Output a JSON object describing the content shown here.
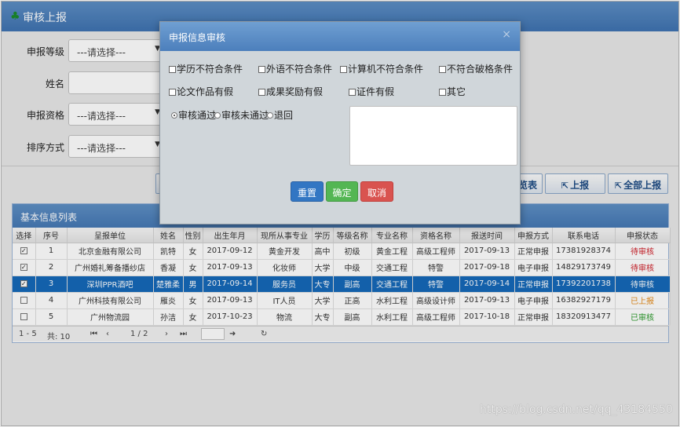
{
  "page": {
    "title": "审核上报",
    "tree_glyph": "♣"
  },
  "search": {
    "fields": [
      {
        "label": "申报等级",
        "type": "select",
        "value": "---请选择---"
      },
      {
        "label": "姓名",
        "type": "input",
        "value": ""
      },
      {
        "label": "申报资格",
        "type": "select",
        "value": "---请选择---"
      },
      {
        "label": "排序方式",
        "type": "select",
        "value": "---请选择---"
      }
    ]
  },
  "actions": {
    "browse_fragment": "览表",
    "report": "上报",
    "report_all": "全部上报"
  },
  "list": {
    "title": "基本信息列表",
    "columns": [
      "选择",
      "序号",
      "呈报单位",
      "姓名",
      "性别",
      "出生年月",
      "现所从事专业",
      "学历",
      "等级名称",
      "专业名称",
      "资格名称",
      "报送时间",
      "申报方式",
      "联系电话",
      "申报状态"
    ],
    "rows": [
      {
        "checked": true,
        "no": "1",
        "unit": "北京金融有限公司",
        "name": "凯特",
        "sex": "女",
        "birth": "2017-09-12",
        "major_now": "黄金开发",
        "edu": "高中",
        "level": "初级",
        "major": "黄金工程",
        "qual": "高级工程师",
        "time": "2017-09-13",
        "mode": "正常申报",
        "phone": "17381928374",
        "status": "待审核",
        "status_class": "st-pending",
        "selected": false
      },
      {
        "checked": true,
        "no": "2",
        "unit": "广州婚礼筹备播纱店",
        "name": "香凝",
        "sex": "女",
        "birth": "2017-09-13",
        "major_now": "化妆师",
        "edu": "大学",
        "level": "中级",
        "major": "交通工程",
        "qual": "特警",
        "time": "2017-09-18",
        "mode": "电子申报",
        "phone": "14829173749",
        "status": "待审核",
        "status_class": "st-pending",
        "selected": false
      },
      {
        "checked": true,
        "no": "3",
        "unit": "深圳PPR酒吧",
        "name": "楚雅柔",
        "sex": "男",
        "birth": "2017-09-14",
        "major_now": "服务员",
        "edu": "大专",
        "level": "副高",
        "major": "交通工程",
        "qual": "特警",
        "time": "2017-09-14",
        "mode": "正常申报",
        "phone": "17392201738",
        "status": "待审核",
        "status_class": "st-pending",
        "selected": true
      },
      {
        "checked": false,
        "no": "4",
        "unit": "广州科技有限公司",
        "name": "雁炎",
        "sex": "女",
        "birth": "2017-09-13",
        "major_now": "IT人员",
        "edu": "大学",
        "level": "正高",
        "major": "水利工程",
        "qual": "高级设计师",
        "time": "2017-09-13",
        "mode": "电子申报",
        "phone": "16382927179",
        "status": "已上报",
        "status_class": "st-reported",
        "selected": false
      },
      {
        "checked": false,
        "no": "5",
        "unit": "广州物流园",
        "name": "孙洁",
        "sex": "女",
        "birth": "2017-10-23",
        "major_now": "物流",
        "edu": "大专",
        "level": "副高",
        "major": "水利工程",
        "qual": "高级工程师",
        "time": "2017-10-18",
        "mode": "正常申报",
        "phone": "18320913477",
        "status": "已审核",
        "status_class": "st-approved",
        "selected": false
      }
    ],
    "pager": {
      "range": "1 - 5",
      "total": "共: 10",
      "page": "1 / 2",
      "first": "⏮",
      "prev": "‹",
      "next": "›",
      "last": "⏭",
      "go": "➜",
      "refresh": "↻"
    }
  },
  "modal": {
    "title": "申报信息审核",
    "close": "×",
    "reasons": [
      "学历不符合条件",
      "外语不符合条件",
      "计算机不符合条件",
      "不符合破格条件",
      "论文作品有假",
      "成果奖励有假",
      "证件有假",
      "其它"
    ],
    "results": [
      {
        "label": "审核通过",
        "checked": true
      },
      {
        "label": "审核未通过",
        "checked": false
      },
      {
        "label": "退回",
        "checked": false
      }
    ],
    "buttons": {
      "reset": "重置",
      "confirm": "确定",
      "cancel": "取消"
    }
  },
  "watermark": "https://blog.csdn.net/qq_43184550",
  "colors": {
    "header": "#4679b5",
    "selected_row": "#1569b9",
    "reset": "#3276c3",
    "confirm": "#53b653",
    "cancel": "#d9534f"
  }
}
